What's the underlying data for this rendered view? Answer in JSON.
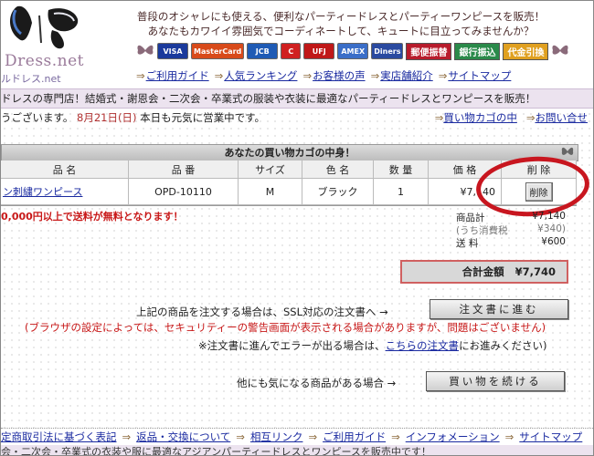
{
  "logo": {
    "text": "Dress.net",
    "sub": "ルドレス.net"
  },
  "tagline": {
    "line1": "普段のオシャレにも使える、便利なパーティードレスとパーティーワンピースを販売！",
    "line2": "あなたもカワイイ雰囲気でコーディネートして、キュートに目立ってみませんか？"
  },
  "payments": {
    "cards": [
      "VISA",
      "MasterCard",
      "JCB",
      "C",
      "UFJ",
      "AMEX",
      "Diners"
    ],
    "methods": [
      "郵便振替",
      "銀行振込",
      "代金引換"
    ],
    "colors": {
      "VISA": "#1b3a9c",
      "MasterCard": "#d84a1a",
      "JCB": "#1f5bb5",
      "C": "#d02020",
      "UFJ": "#c01818",
      "AMEX": "#3a6ec8",
      "Diners": "#2a4aa0",
      "郵便振替": "#b81c2c",
      "銀行振込": "#2a8a4a",
      "代金引換": "#e0a020"
    }
  },
  "topnav": [
    "ご利用ガイド",
    "人気ランキング",
    "お客様の声",
    "実店舗紹介",
    "サイトマップ"
  ],
  "banner": "ドレスの専門店！結婚式・謝恩会・二次会・卒業式の服装や衣装に最適なパーティードレスとワンピースを販売！",
  "notice": {
    "prefix": "うございます。",
    "date": "8月21日(日)",
    "suffix": " 本日も元気に営業中です。"
  },
  "notice_links": [
    "買い物カゴの中",
    "お問い合せ"
  ],
  "cart": {
    "title": "あなたの買い物カゴの中身！",
    "headers": [
      "品 名",
      "品 番",
      "サイズ",
      "色 名",
      "数 量",
      "価 格",
      "削 除"
    ],
    "rows": [
      {
        "name": "ン刺繍ワンピース",
        "code": "OPD-10110",
        "size": "M",
        "color": "ブラック",
        "qty": "1",
        "price": "¥7,140",
        "delete": "削除"
      }
    ]
  },
  "free_shipping": "0,000円以上で送料が無料となります！",
  "summary": {
    "subtotal_label": "商品計",
    "subtotal": "¥7,140",
    "tax_label": "(うち消費税",
    "tax": "¥340)",
    "shipping_label": "送 料",
    "shipping": "¥600",
    "total_label": "合計金額",
    "total": "¥7,740"
  },
  "instructions": {
    "ssl": "上記の商品を注文する場合は、SSL対応の注文書へ →",
    "warning": "(ブラウザの設定によっては、セキュリティーの警告画面が表示される場合がありますが、問題はございません)",
    "error_prefix": "※注文書に進んでエラーが出る場合は、",
    "error_link": "こちらの注文書",
    "error_suffix": "にお進みください)",
    "order_button": "注文書に進む",
    "continue_text": "他にも気になる商品がある場合 →",
    "continue_button": "買い物を続ける"
  },
  "footer": {
    "links": [
      "定商取引法に基づく表記",
      "返品・交換について",
      "相互リンク",
      "ご利用ガイド",
      "インフォメーション",
      "サイトマップ"
    ],
    "tagline": "会・二次会・卒業式の衣装や服に最適なアジアンパーティードレスとワンピースを販売中です！"
  }
}
